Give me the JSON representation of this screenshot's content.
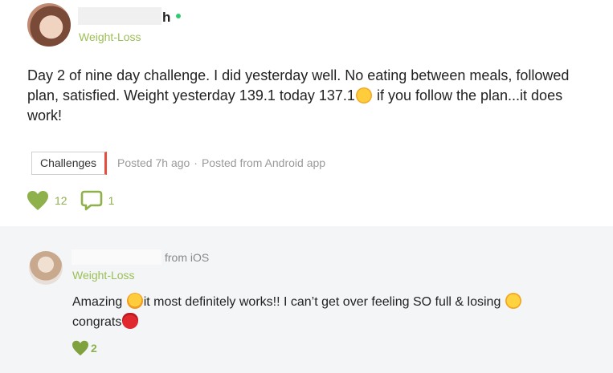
{
  "post": {
    "author_visible_suffix": "h",
    "group": "Weight-Loss",
    "body": "Day 2 of nine day challenge. I did yesterday well. No eating between meals, followed plan, satisfied. Weight yesterday 139.1 today 137.1",
    "body_after_emoji": " if you follow the plan...it does work!",
    "tag": "Challenges",
    "posted": "Posted 7h ago",
    "separator": "·",
    "posted_from": "Posted from Android app",
    "likes": "12",
    "comments": "1"
  },
  "reply": {
    "source": "from iOS",
    "group": "Weight-Loss",
    "text_before": "Amazing ",
    "text_middle": "it most definitely works!! I can’t get over feeling SO full & losing ",
    "text_end": "congrats",
    "likes": "2"
  },
  "colors": {
    "accent_green": "#8fb14c",
    "tag_accent": "#e74c3c",
    "reply_background": "#f3f5f7"
  },
  "icons": [
    "heart-icon",
    "comment-icon",
    "online-status-dot",
    "smiley-emoji",
    "tired-emoji",
    "upside-down-emoji",
    "strawberry-emoji"
  ]
}
